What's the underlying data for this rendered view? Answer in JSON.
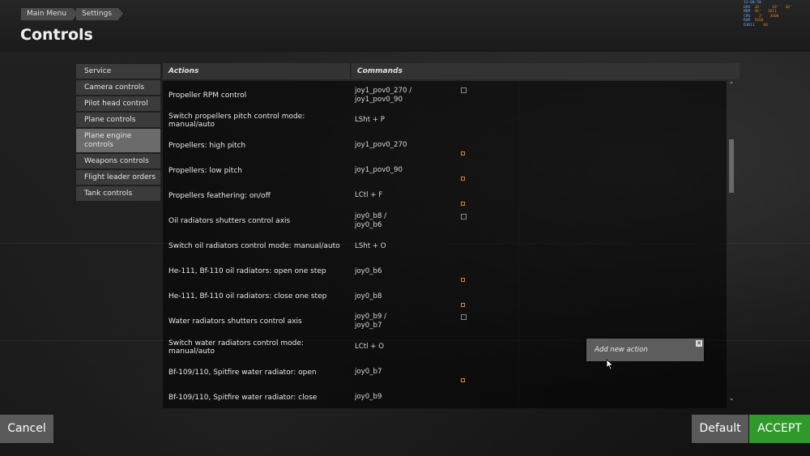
{
  "breadcrumb": [
    "Main Menu",
    "Settings"
  ],
  "page_title": "Controls",
  "perf_overlay": {
    "clock": "12:00:58",
    "lines": [
      {
        "label": "GPU",
        "values": "  36'     43'   30'"
      },
      {
        "label": "MEM",
        "values": "  46'   1611"
      },
      {
        "label": "CPU",
        "values": "    2'   3600"
      },
      {
        "label": "RAM",
        "values": "  5650"
      },
      {
        "label": "D3D11",
        "values": "    60"
      }
    ]
  },
  "sidebar": {
    "items": [
      {
        "label": "Service",
        "active": false
      },
      {
        "label": "Camera controls",
        "active": false
      },
      {
        "label": "Pilot head control",
        "active": false
      },
      {
        "label": "Plane controls",
        "active": false
      },
      {
        "label": "Plane engine controls",
        "active": true
      },
      {
        "label": "Weapons controls",
        "active": false
      },
      {
        "label": "Flight leader orders",
        "active": false
      },
      {
        "label": "Tank controls",
        "active": false
      }
    ]
  },
  "table": {
    "headers": {
      "actions": "Actions",
      "commands": "Commands"
    },
    "rows": [
      {
        "action": "Propeller RPM control",
        "commands": [
          "joy1_pov0_270 /",
          "joy1_pov0_90"
        ],
        "icon": "axis-settings-icon"
      },
      {
        "action": "Switch propellers pitch control mode: manual/auto",
        "commands": [
          "LSht + P"
        ],
        "icon": ""
      },
      {
        "action": "Propellers: high pitch",
        "commands": [
          "joy1_pov0_270"
        ],
        "icon": "binding-icon"
      },
      {
        "action": "Propellers: low pitch",
        "commands": [
          "joy1_pov0_90"
        ],
        "icon": "binding-icon"
      },
      {
        "action": "Propellers feathering: on/off",
        "commands": [
          "LCtl + F"
        ],
        "icon": "binding-icon"
      },
      {
        "action": "Oil radiators shutters control axis",
        "commands": [
          "joy0_b8 /",
          "joy0_b6"
        ],
        "icon": "axis-settings-icon"
      },
      {
        "action": "Switch oil radiators control mode: manual/auto",
        "commands": [
          "LSht + O"
        ],
        "icon": ""
      },
      {
        "action": "He-111, Bf-110 oil radiators: open one step",
        "commands": [
          "joy0_b6"
        ],
        "icon": "binding-icon"
      },
      {
        "action": "He-111, Bf-110 oil radiators: close one step",
        "commands": [
          "joy0_b8"
        ],
        "icon": "binding-icon"
      },
      {
        "action": "Water radiators shutters control axis",
        "commands": [
          "joy0_b9 /",
          "joy0_b7"
        ],
        "icon": "axis-settings-icon"
      },
      {
        "action": "Switch water radiators control mode: manual/auto",
        "commands": [
          "LCtl + O"
        ],
        "icon": ""
      },
      {
        "action": "Bf-109/110, Spitfire water radiator: open",
        "commands": [
          "joy0_b7"
        ],
        "icon": "binding-icon"
      },
      {
        "action": "Bf-109/110, Spitfire water radiator: close",
        "commands": [
          "joy0_b9"
        ],
        "icon": ""
      }
    ]
  },
  "add_action_popup": {
    "label": "Add new action"
  },
  "buttons": {
    "cancel": "Cancel",
    "default": "Default",
    "accept": "ACCEPT"
  },
  "colors": {
    "accent_green": "#2f9a2a",
    "binding_orange": "#e0822a"
  }
}
